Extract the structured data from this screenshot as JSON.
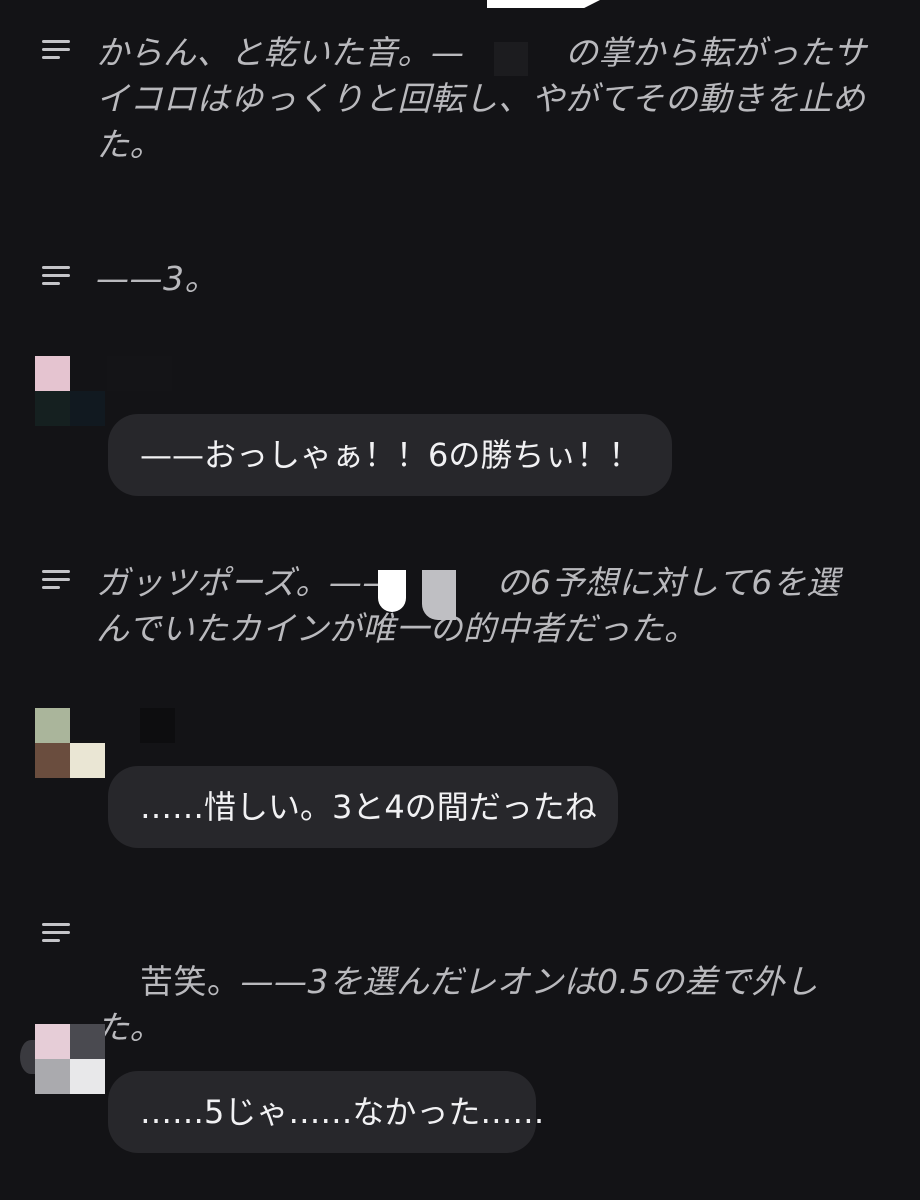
{
  "chat": {
    "narrations": [
      {
        "prefix": "",
        "text": "からん、と乾いた音。—　　　の掌から転がったサイコロはゆっくりと回転し、やがてその動きを止めた。"
      },
      {
        "prefix": "",
        "text": "——3。"
      },
      {
        "prefix": "",
        "text": "ガッツポーズ。——　　　の6予想に対して6を選んでいたカインが唯一の的中者だった。"
      },
      {
        "prefix": "苦笑。",
        "text": "——3を選んだレオンは0.5の差で外した。"
      }
    ],
    "messages": [
      {
        "text": "——おっしゃぁ！！6の勝ちぃ！！"
      },
      {
        "text": "……惜しい。3と4の間だったね"
      },
      {
        "text": "……5じゃ……なかった……"
      }
    ]
  },
  "icons": {
    "narration": "narration-lines-icon"
  }
}
